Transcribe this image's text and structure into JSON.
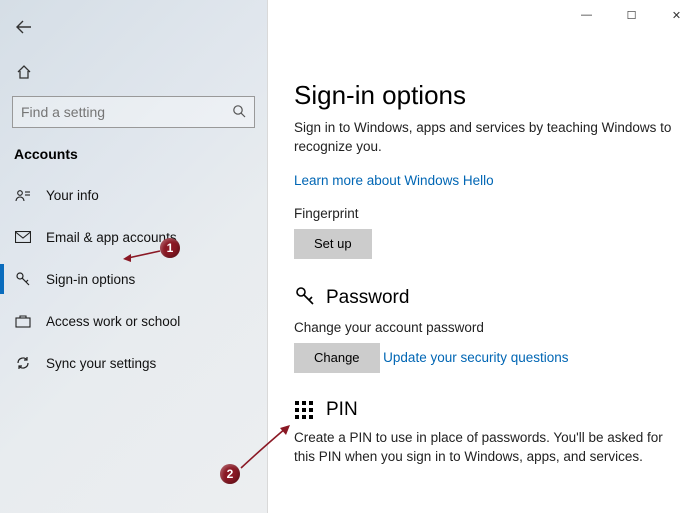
{
  "titlebar": {
    "minimize": "—",
    "maximize": "☐",
    "close": "✕"
  },
  "sidebar": {
    "search_placeholder": "Find a setting",
    "category": "Accounts",
    "items": [
      {
        "label": "Your info"
      },
      {
        "label": "Email & app accounts"
      },
      {
        "label": "Sign-in options"
      },
      {
        "label": "Access work or school"
      },
      {
        "label": "Sync your settings"
      }
    ]
  },
  "content": {
    "title": "Sign-in options",
    "subtitle": "Sign in to Windows, apps and services by teaching Windows to recognize you.",
    "hello_link": "Learn more about Windows Hello",
    "fingerprint_label": "Fingerprint",
    "setup_btn": "Set up",
    "password_heading": "Password",
    "password_desc": "Change your account password",
    "change_btn": "Change",
    "security_link": "Update your security questions",
    "pin_heading": "PIN",
    "pin_desc": "Create a PIN to use in place of passwords. You'll be asked for this PIN when you sign in to Windows, apps, and services."
  },
  "annotations": {
    "one": "1",
    "two": "2"
  }
}
